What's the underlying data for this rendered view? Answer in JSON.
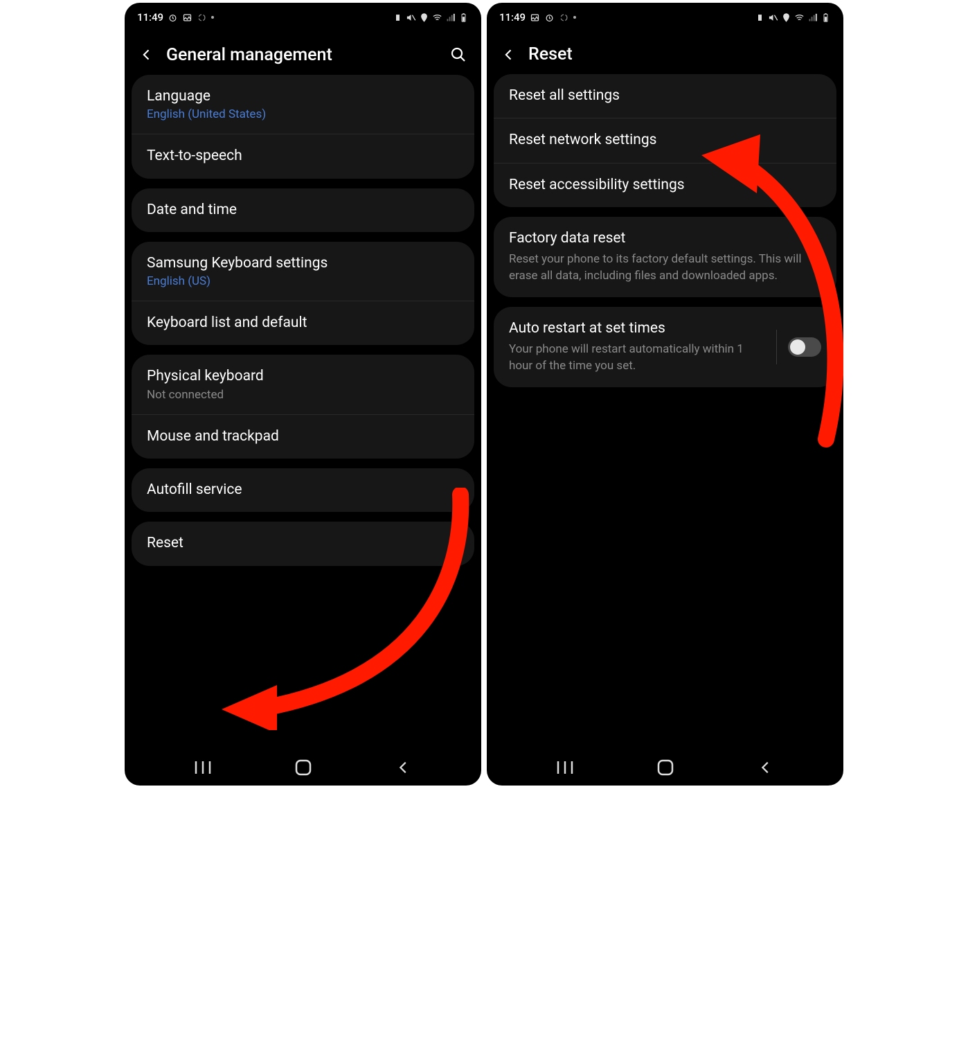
{
  "left": {
    "status": {
      "time": "11:49"
    },
    "header": {
      "title": "General management"
    },
    "groups": [
      {
        "items": [
          {
            "title": "Language",
            "sub": "English (United States)",
            "sub_color": "blue"
          },
          {
            "title": "Text-to-speech"
          }
        ]
      },
      {
        "items": [
          {
            "title": "Date and time"
          }
        ]
      },
      {
        "items": [
          {
            "title": "Samsung Keyboard settings",
            "sub": "English (US)",
            "sub_color": "blue"
          },
          {
            "title": "Keyboard list and default"
          }
        ]
      },
      {
        "items": [
          {
            "title": "Physical keyboard",
            "sub": "Not connected",
            "sub_color": "grey"
          },
          {
            "title": "Mouse and trackpad"
          }
        ]
      },
      {
        "items": [
          {
            "title": "Autofill service"
          }
        ]
      },
      {
        "items": [
          {
            "title": "Reset"
          }
        ]
      }
    ]
  },
  "right": {
    "status": {
      "time": "11:49"
    },
    "header": {
      "title": "Reset"
    },
    "groups": [
      {
        "items": [
          {
            "title": "Reset all settings"
          },
          {
            "title": "Reset network settings"
          },
          {
            "title": "Reset accessibility settings"
          }
        ]
      },
      {
        "items": [
          {
            "title": "Factory data reset",
            "desc": "Reset your phone to its factory default settings. This will erase all data, including files and downloaded apps."
          }
        ]
      },
      {
        "items": [
          {
            "title": "Auto restart at set times",
            "desc": "Your phone will restart automatically within 1 hour of the time you set.",
            "toggle": true,
            "toggle_on": false
          }
        ]
      }
    ]
  }
}
